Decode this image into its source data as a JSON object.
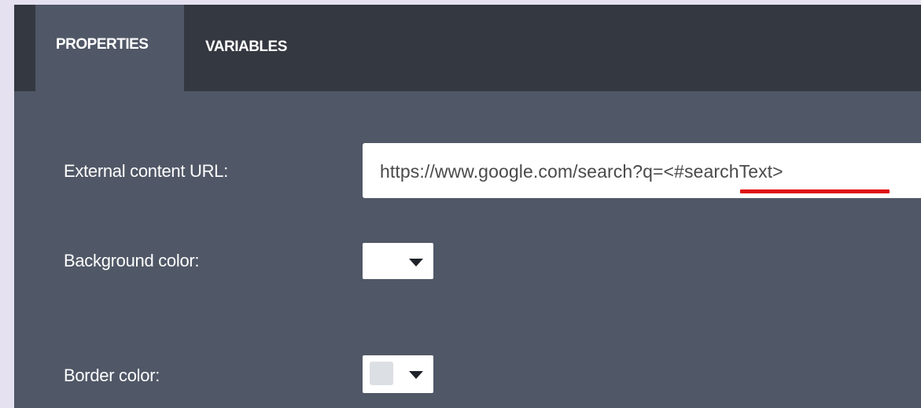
{
  "tabs": [
    {
      "label": "PROPERTIES",
      "active": true
    },
    {
      "label": "VARIABLES",
      "active": false
    }
  ],
  "fields": {
    "external_url": {
      "label": "External content URL:",
      "value": "https://www.google.com/search?q=<#searchText>"
    },
    "background_color": {
      "label": "Background color:",
      "swatch": "#ffffff",
      "icon": "caret-down-icon"
    },
    "border_color": {
      "label": "Border color:",
      "swatch": "#dcdfe3",
      "icon": "caret-down-icon"
    }
  },
  "colors": {
    "page_background": "#e5e1f1",
    "panel": "#505766",
    "tab_bar": "#343840",
    "highlight_underline": "#e01010"
  }
}
